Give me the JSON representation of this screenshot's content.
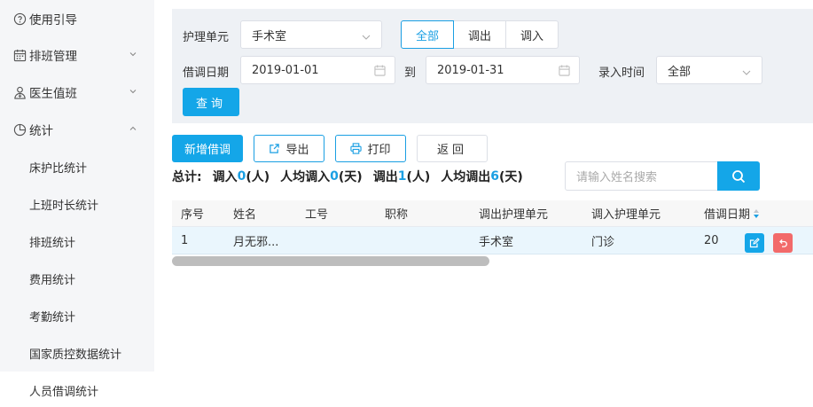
{
  "sidebar": {
    "items": [
      {
        "label": "使用引导",
        "icon": "help-circle-icon"
      },
      {
        "label": "排班管理",
        "icon": "calendar-icon",
        "chevron": "down"
      },
      {
        "label": "医生值班",
        "icon": "doctor-icon",
        "chevron": "down"
      },
      {
        "label": "统计",
        "icon": "pie-chart-icon",
        "chevron": "up"
      }
    ],
    "sub_items": [
      {
        "label": "床护比统计"
      },
      {
        "label": "上班时长统计"
      },
      {
        "label": "排班统计"
      },
      {
        "label": "费用统计"
      },
      {
        "label": "考勤统计"
      },
      {
        "label": "国家质控数据统计"
      },
      {
        "label": "人员借调统计",
        "active": true
      }
    ]
  },
  "filters": {
    "unit_label": "护理单元",
    "unit_value": "手术室",
    "direction_options": [
      "全部",
      "调出",
      "调入"
    ],
    "direction_selected": "全部",
    "date_label": "借调日期",
    "date_from": "2019-01-01",
    "date_to_label": "到",
    "date_to": "2019-01-31",
    "entry_time_label": "录入时间",
    "entry_time_value": "全部",
    "query_label": "查询"
  },
  "toolbar": {
    "add_label": "新增借调",
    "export_label": "导出",
    "print_label": "打印",
    "back_label": "返回"
  },
  "summary": {
    "total_label": "总计:",
    "in_label": "调入",
    "in_value": "0",
    "in_unit": "(人)",
    "avg_in_label": "人均调入",
    "avg_in_value": "0",
    "avg_in_unit": "(天)",
    "out_label": "调出",
    "out_value": "1",
    "out_unit": "(人)",
    "avg_out_label": "人均调出",
    "avg_out_value": "6",
    "avg_out_unit": "(天)"
  },
  "search": {
    "placeholder": "请输入姓名搜索"
  },
  "table": {
    "columns": [
      "序号",
      "姓名",
      "工号",
      "职称",
      "调出护理单元",
      "调入护理单元",
      "借调日期"
    ],
    "rows": [
      {
        "index": "1",
        "name": "月无邪...",
        "staff_id": "",
        "title": "",
        "out_unit": "手术室",
        "in_unit": "门诊",
        "date": "20"
      }
    ]
  },
  "colors": {
    "accent": "#14a6e8",
    "danger": "#f26a6a",
    "sidebar_bg": "#f5f6f8",
    "filter_bg": "#eef1f5",
    "row_highlight": "#eaf6fd"
  }
}
